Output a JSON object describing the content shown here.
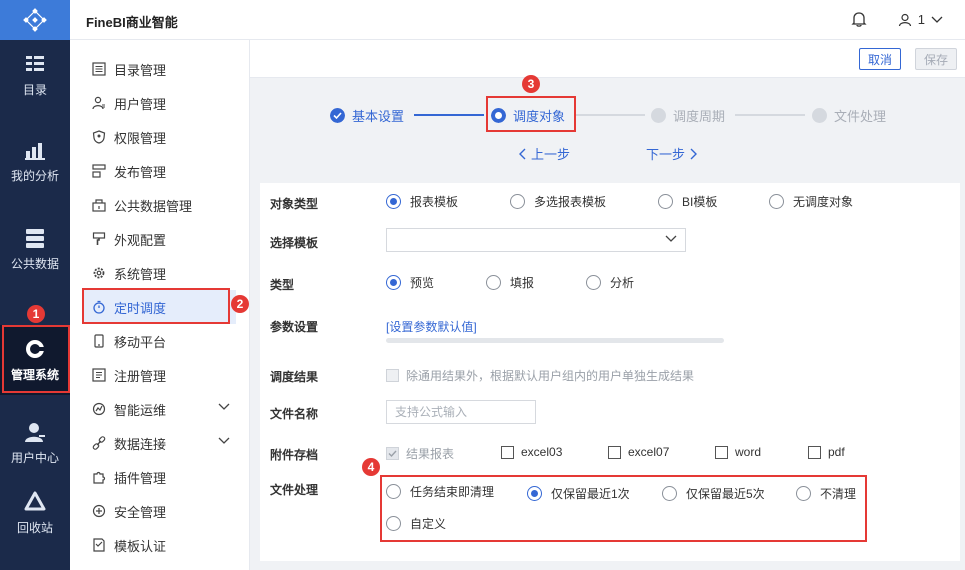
{
  "header": {
    "app_title": "FineBI商业智能",
    "user_label": "1"
  },
  "leftnav": [
    {
      "label": "目录",
      "icon": "catalog-icon"
    },
    {
      "label": "我的分析",
      "icon": "analysis-icon"
    },
    {
      "label": "公共数据",
      "icon": "database-icon"
    },
    {
      "label": "管理系统",
      "icon": "gear-icon"
    },
    {
      "label": "用户中心",
      "icon": "user-icon"
    },
    {
      "label": "回收站",
      "icon": "recycle-icon"
    }
  ],
  "menu": [
    {
      "label": "目录管理"
    },
    {
      "label": "用户管理"
    },
    {
      "label": "权限管理"
    },
    {
      "label": "发布管理"
    },
    {
      "label": "公共数据管理"
    },
    {
      "label": "外观配置"
    },
    {
      "label": "系统管理"
    },
    {
      "label": "定时调度"
    },
    {
      "label": "移动平台"
    },
    {
      "label": "注册管理"
    },
    {
      "label": "智能运维"
    },
    {
      "label": "数据连接"
    },
    {
      "label": "插件管理"
    },
    {
      "label": "安全管理"
    },
    {
      "label": "模板认证"
    }
  ],
  "toolbar": {
    "cancel": "取消",
    "save": "保存"
  },
  "steps": [
    {
      "label": "基本设置"
    },
    {
      "label": "调度对象"
    },
    {
      "label": "调度周期"
    },
    {
      "label": "文件处理"
    }
  ],
  "pager": {
    "prev": "上一步",
    "next": "下一步"
  },
  "form": {
    "object_type": {
      "label": "对象类型",
      "options": [
        "报表模板",
        "多选报表模板",
        "BI模板",
        "无调度对象"
      ],
      "selected": "报表模板"
    },
    "template": {
      "label": "选择模板",
      "value": ""
    },
    "type": {
      "label": "类型",
      "options": [
        "预览",
        "填报",
        "分析"
      ],
      "selected": "预览"
    },
    "params": {
      "label": "参数设置",
      "link": "[设置参数默认值]"
    },
    "result": {
      "label": "调度结果",
      "text": "除通用结果外，根据默认用户组内的用户单独生成结果"
    },
    "filename": {
      "label": "文件名称",
      "placeholder": "支持公式输入"
    },
    "attachment": {
      "label": "附件存档",
      "options": [
        "结果报表",
        "excel03",
        "excel07",
        "word",
        "pdf"
      ]
    },
    "file_handling": {
      "label": "文件处理",
      "options": [
        "任务结束即清理",
        "仅保留最近1次",
        "仅保留最近5次",
        "不清理",
        "自定义"
      ],
      "selected": "仅保留最近1次"
    }
  },
  "badges": [
    "1",
    "2",
    "3",
    "4"
  ],
  "colors": {
    "primary": "#3467d4",
    "nav_bg": "#1b2a4a",
    "highlight": "#e53935"
  }
}
